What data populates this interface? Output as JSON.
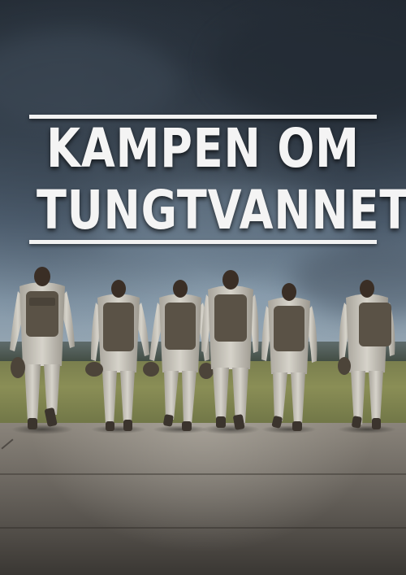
{
  "poster": {
    "title_line1": "KAMPEN OM",
    "title_line2": "TUNGTVANNET"
  },
  "scene": {
    "figures": [
      {
        "name": "soldier-1"
      },
      {
        "name": "soldier-2"
      },
      {
        "name": "soldier-3"
      },
      {
        "name": "soldier-4"
      },
      {
        "name": "soldier-5"
      },
      {
        "name": "soldier-6"
      }
    ],
    "colors": {
      "sky_dark": "#1c232b",
      "sky_light": "#9cabb6",
      "field": "#8a8e56",
      "tarmac": "#6f6a63",
      "suit": "#c9c6bd",
      "backpack": "#5a5246",
      "title": "#f4f4f4"
    }
  }
}
